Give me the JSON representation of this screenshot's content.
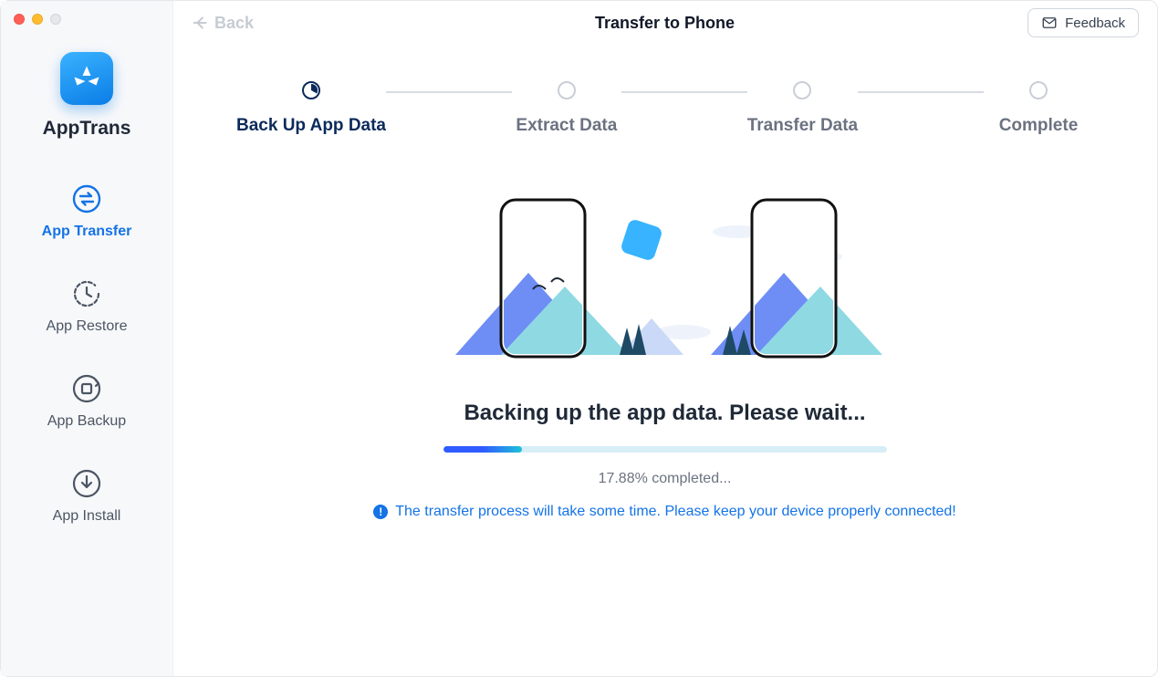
{
  "app": {
    "name": "AppTrans"
  },
  "sidebar": {
    "items": [
      {
        "label": "App Transfer",
        "id": "transfer",
        "active": true
      },
      {
        "label": "App Restore",
        "id": "restore",
        "active": false
      },
      {
        "label": "App Backup",
        "id": "backup",
        "active": false
      },
      {
        "label": "App Install",
        "id": "install",
        "active": false
      }
    ]
  },
  "header": {
    "back_label": "Back",
    "title": "Transfer to Phone",
    "feedback_label": "Feedback"
  },
  "steps": [
    {
      "label": "Back Up App Data",
      "state": "active"
    },
    {
      "label": "Extract Data",
      "state": "pending"
    },
    {
      "label": "Transfer Data",
      "state": "pending"
    },
    {
      "label": "Complete",
      "state": "pending"
    }
  ],
  "status": {
    "title": "Backing up the app data. Please wait...",
    "progress_percent": 17.88,
    "progress_text": "17.88% completed...",
    "hint": "The transfer process will take some time. Please keep your device properly connected!"
  }
}
